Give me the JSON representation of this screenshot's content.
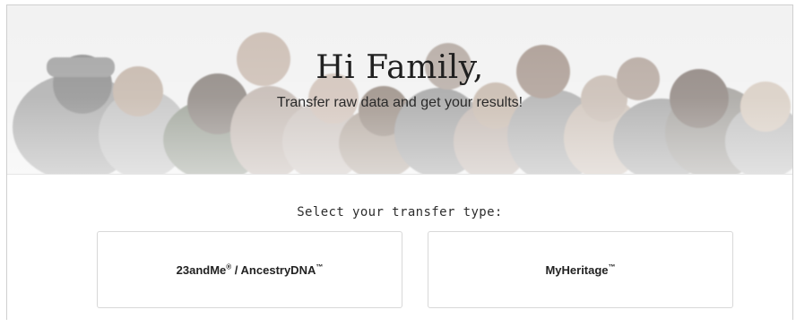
{
  "hero": {
    "title": "Hi Family,",
    "subtitle": "Transfer raw data and get your results!"
  },
  "transfer": {
    "heading": "Select your transfer type:",
    "options": [
      {
        "brand_1": "23andMe",
        "mark_1": "®",
        "separator": " / ",
        "brand_2": "AncestryDNA",
        "mark_2": "™"
      },
      {
        "brand_1": "MyHeritage",
        "mark_1": "™"
      }
    ]
  },
  "colors": {
    "text": "#222222",
    "border": "#d8d8d8",
    "hero_background": "#ececec"
  }
}
